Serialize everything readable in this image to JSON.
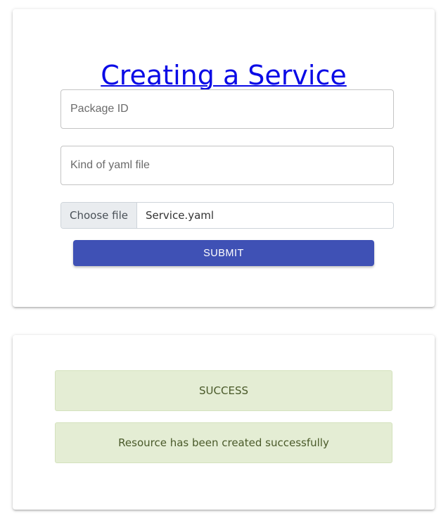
{
  "form": {
    "title": "Creating a Service",
    "package_id_placeholder": "Package ID",
    "kind_placeholder": "Kind of yaml file",
    "file_button_label": "Choose file",
    "file_name": "Service.yaml",
    "submit_label": "SUBMIT"
  },
  "result": {
    "status": "SUCCESS",
    "message": "Resource has been created successfully"
  },
  "colors": {
    "title_link": "#0a0ae6",
    "submit_button": "#3f51b5",
    "alert_background": "#e4edd4",
    "alert_text": "#4a5a2a"
  }
}
